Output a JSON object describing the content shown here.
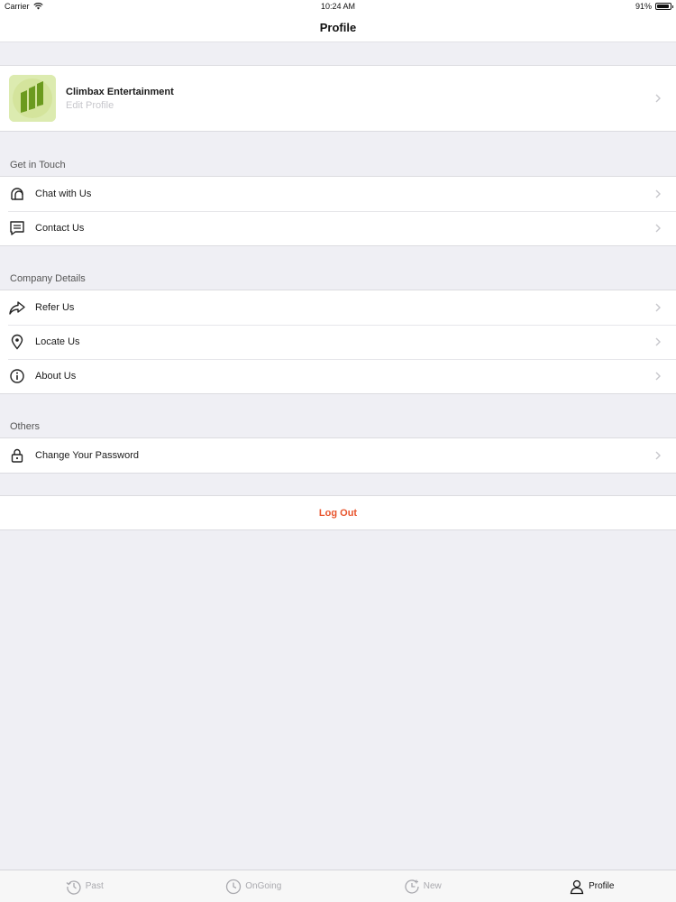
{
  "status_bar": {
    "carrier": "Carrier",
    "time": "10:24 AM",
    "battery": "91%",
    "battery_level": 0.91
  },
  "nav": {
    "title": "Profile"
  },
  "profile": {
    "name": "Climbax Entertainment",
    "subtitle": "Edit Profile"
  },
  "sections": [
    {
      "header": "Get in Touch",
      "items": [
        {
          "label": "Chat with Us",
          "icon": "chat-icon"
        },
        {
          "label": "Contact Us",
          "icon": "message-icon"
        }
      ]
    },
    {
      "header": "Company Details",
      "items": [
        {
          "label": "Refer Us",
          "icon": "share-icon"
        },
        {
          "label": "Locate Us",
          "icon": "location-pin-icon"
        },
        {
          "label": "About Us",
          "icon": "info-icon"
        }
      ]
    },
    {
      "header": "Others",
      "items": [
        {
          "label": "Change Your Password",
          "icon": "lock-icon"
        }
      ]
    }
  ],
  "logout": {
    "label": "Log Out",
    "color": "#e8552e"
  },
  "tabs": [
    {
      "label": "Past",
      "icon": "history-icon",
      "active": false
    },
    {
      "label": "OnGoing",
      "icon": "clock-icon",
      "active": false
    },
    {
      "label": "New",
      "icon": "new-clock-icon",
      "active": false
    },
    {
      "label": "Profile",
      "icon": "user-icon",
      "active": true
    }
  ]
}
